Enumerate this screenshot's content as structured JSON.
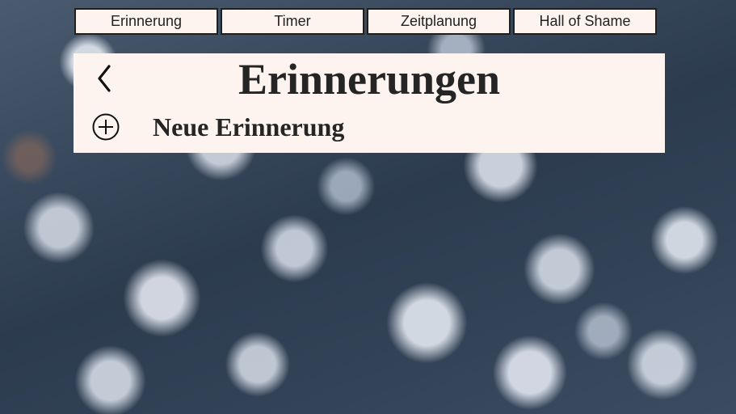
{
  "nav": {
    "tabs": [
      {
        "label": "Erinnerung"
      },
      {
        "label": "Timer"
      },
      {
        "label": "Zeitplanung"
      },
      {
        "label": "Hall of Shame"
      }
    ]
  },
  "panel": {
    "title": "Erinnerungen",
    "back_icon": "chevron-left-icon",
    "add_icon": "plus-circle-icon",
    "new_label": "Neue Erinnerung"
  },
  "colors": {
    "panel_background": "#fdf3ef",
    "text": "#252525",
    "tab_border": "#1f1f1f"
  }
}
